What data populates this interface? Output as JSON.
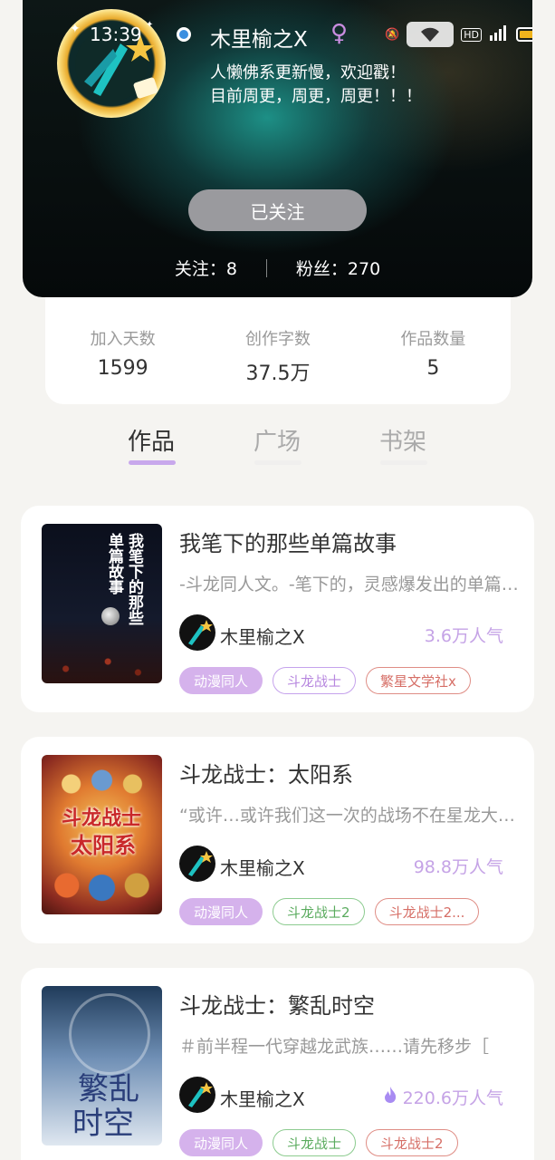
{
  "status_bar": {
    "time": "13:39"
  },
  "profile": {
    "name": "木里榆之X",
    "gender_symbol": "♀",
    "bio": "人懒佛系更新慢，欢迎戳！\n目前周更，周更，周更！！！",
    "follow_button": "已关注",
    "following_label": "关注：8",
    "fans_label": "粉丝：270"
  },
  "stats": [
    {
      "label": "加入天数",
      "value": "1599"
    },
    {
      "label": "创作字数",
      "value": "37.5万"
    },
    {
      "label": "作品数量",
      "value": "5"
    }
  ],
  "tabs": [
    {
      "label": "作品",
      "active": true
    },
    {
      "label": "广场",
      "active": false
    },
    {
      "label": "书架",
      "active": false
    }
  ],
  "books": [
    {
      "title": "我笔下的那些单篇故事",
      "cover_text": [
        "我笔下的那些",
        "单篇故事"
      ],
      "description": "-斗龙同人文。-笔下的，灵感爆发出的单篇故事",
      "author": "木里榆之X",
      "popularity": "3.6万人气",
      "tags": [
        {
          "label": "动漫同人",
          "style": "purple"
        },
        {
          "label": "斗龙战士",
          "style": "lilac"
        },
        {
          "label": "繁星文学社x",
          "style": "red"
        }
      ]
    },
    {
      "title": "斗龙战士：太阳系",
      "cover_text": [
        "斗龙战士",
        "太阳系"
      ],
      "description": "“或许…或许我们这一次的战场不在星龙大陆”",
      "author": "木里榆之X",
      "popularity": "98.8万人气",
      "tags": [
        {
          "label": "动漫同人",
          "style": "purple"
        },
        {
          "label": "斗龙战士2",
          "style": "green"
        },
        {
          "label": "斗龙战士2...",
          "style": "red"
        }
      ]
    },
    {
      "title": "斗龙战士：繁乱时空",
      "cover_text": [
        "繁乱",
        "时空"
      ],
      "description": "＃前半程一代穿越龙武族……请先移步［",
      "author": "木里榆之X",
      "popularity": "220.6万人气",
      "tags": [
        {
          "label": "动漫同人",
          "style": "purple"
        },
        {
          "label": "斗龙战士",
          "style": "green"
        },
        {
          "label": "斗龙战士2",
          "style": "red"
        }
      ]
    }
  ],
  "colors": {
    "accent": "#c8a8ec",
    "tag_purple": "#d5b2ec",
    "popularity": "#c5a3e6"
  }
}
